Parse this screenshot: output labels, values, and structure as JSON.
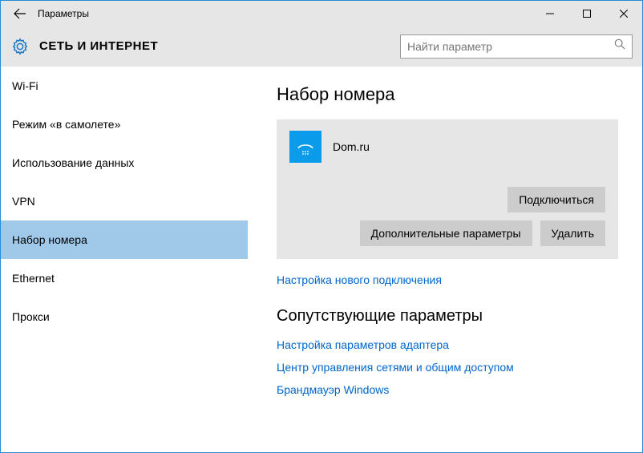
{
  "window": {
    "title": "Параметры"
  },
  "header": {
    "category": "СЕТЬ И ИНТЕРНЕТ",
    "search_placeholder": "Найти параметр"
  },
  "sidebar": {
    "items": [
      {
        "label": "Wi-Fi"
      },
      {
        "label": "Режим «в самолете»"
      },
      {
        "label": "Использование данных"
      },
      {
        "label": "VPN"
      },
      {
        "label": "Набор номера"
      },
      {
        "label": "Ethernet"
      },
      {
        "label": "Прокси"
      }
    ],
    "selected_index": 4
  },
  "main": {
    "title": "Набор номера",
    "connection": {
      "name": "Dom.ru"
    },
    "buttons": {
      "connect": "Подключиться",
      "advanced": "Дополнительные параметры",
      "delete": "Удалить"
    },
    "new_connection_link": "Настройка нового подключения",
    "related": {
      "title": "Сопутствующие параметры",
      "links": [
        "Настройка параметров адаптера",
        "Центр управления сетями и общим доступом",
        "Брандмауэр Windows"
      ]
    }
  }
}
